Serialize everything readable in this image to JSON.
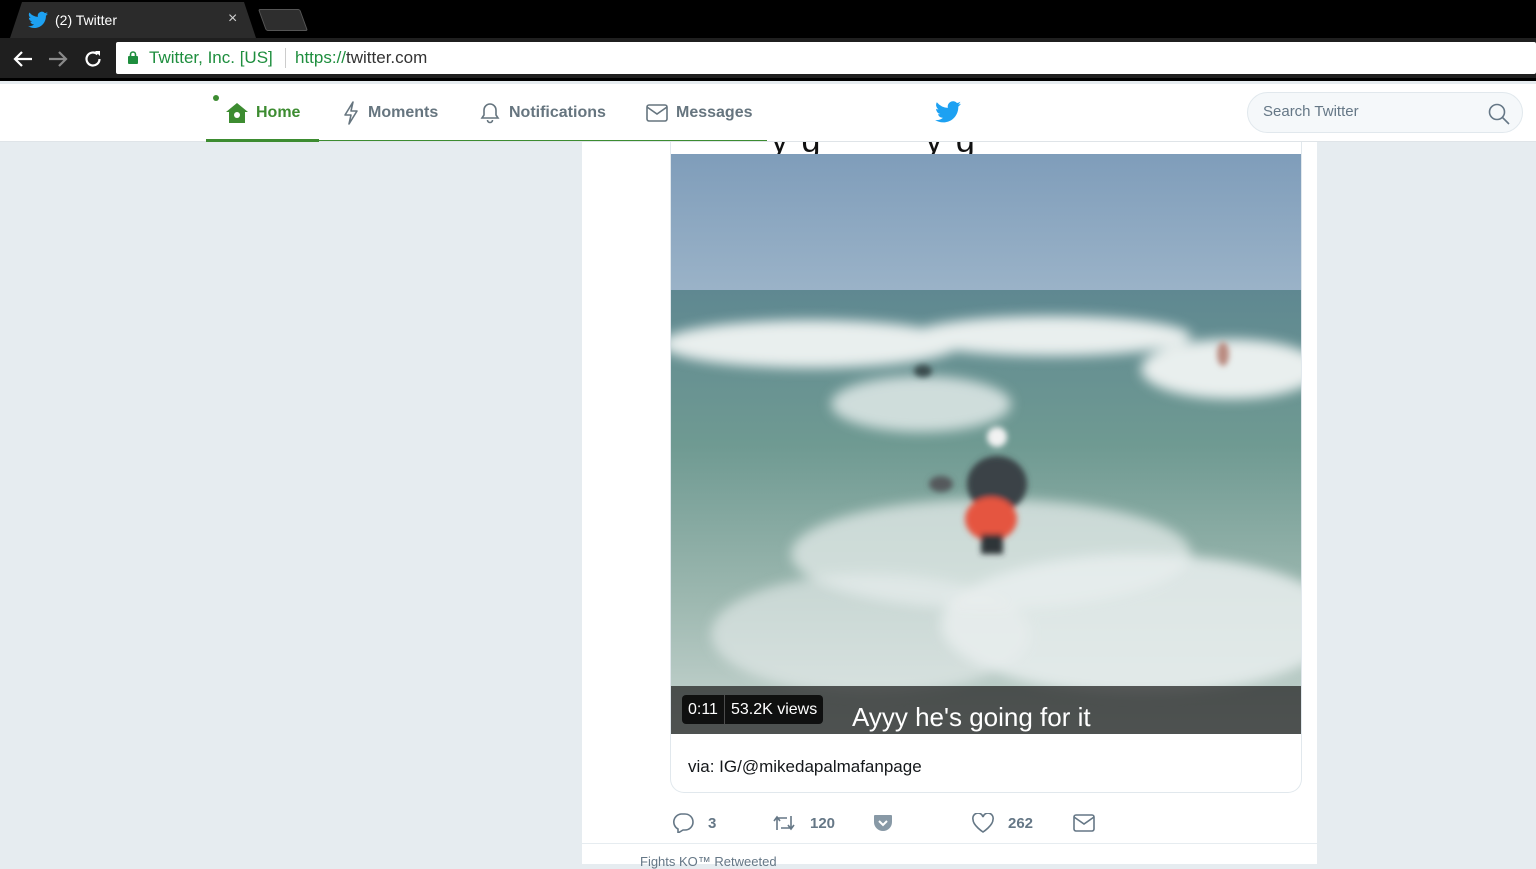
{
  "browser": {
    "tab_title": "(2) Twitter",
    "tab_close": "×",
    "secure_label": "Twitter, Inc. [US]",
    "url_scheme": "https://",
    "url_host": "twitter.com"
  },
  "twitter_nav": {
    "items": [
      {
        "label": "Home",
        "icon": "home-icon",
        "active": true
      },
      {
        "label": "Moments",
        "icon": "lightning-icon",
        "active": false
      },
      {
        "label": "Notifications",
        "icon": "bell-icon",
        "active": false
      },
      {
        "label": "Messages",
        "icon": "envelope-icon",
        "active": false
      }
    ],
    "search_placeholder": "Search Twitter",
    "accent_color": "#3d8c31",
    "brand_color": "#1da1f2"
  },
  "tweet": {
    "video": {
      "duration": "0:11",
      "views": "53.2K views",
      "subtitle": "Ayyy he's going for it"
    },
    "card_caption": "via: IG/@mikedapalmafanpage",
    "stats": {
      "replies": "3",
      "retweets": "120",
      "likes": "262"
    }
  },
  "next_tweet": {
    "context": "Fights KO™ Retweeted"
  }
}
